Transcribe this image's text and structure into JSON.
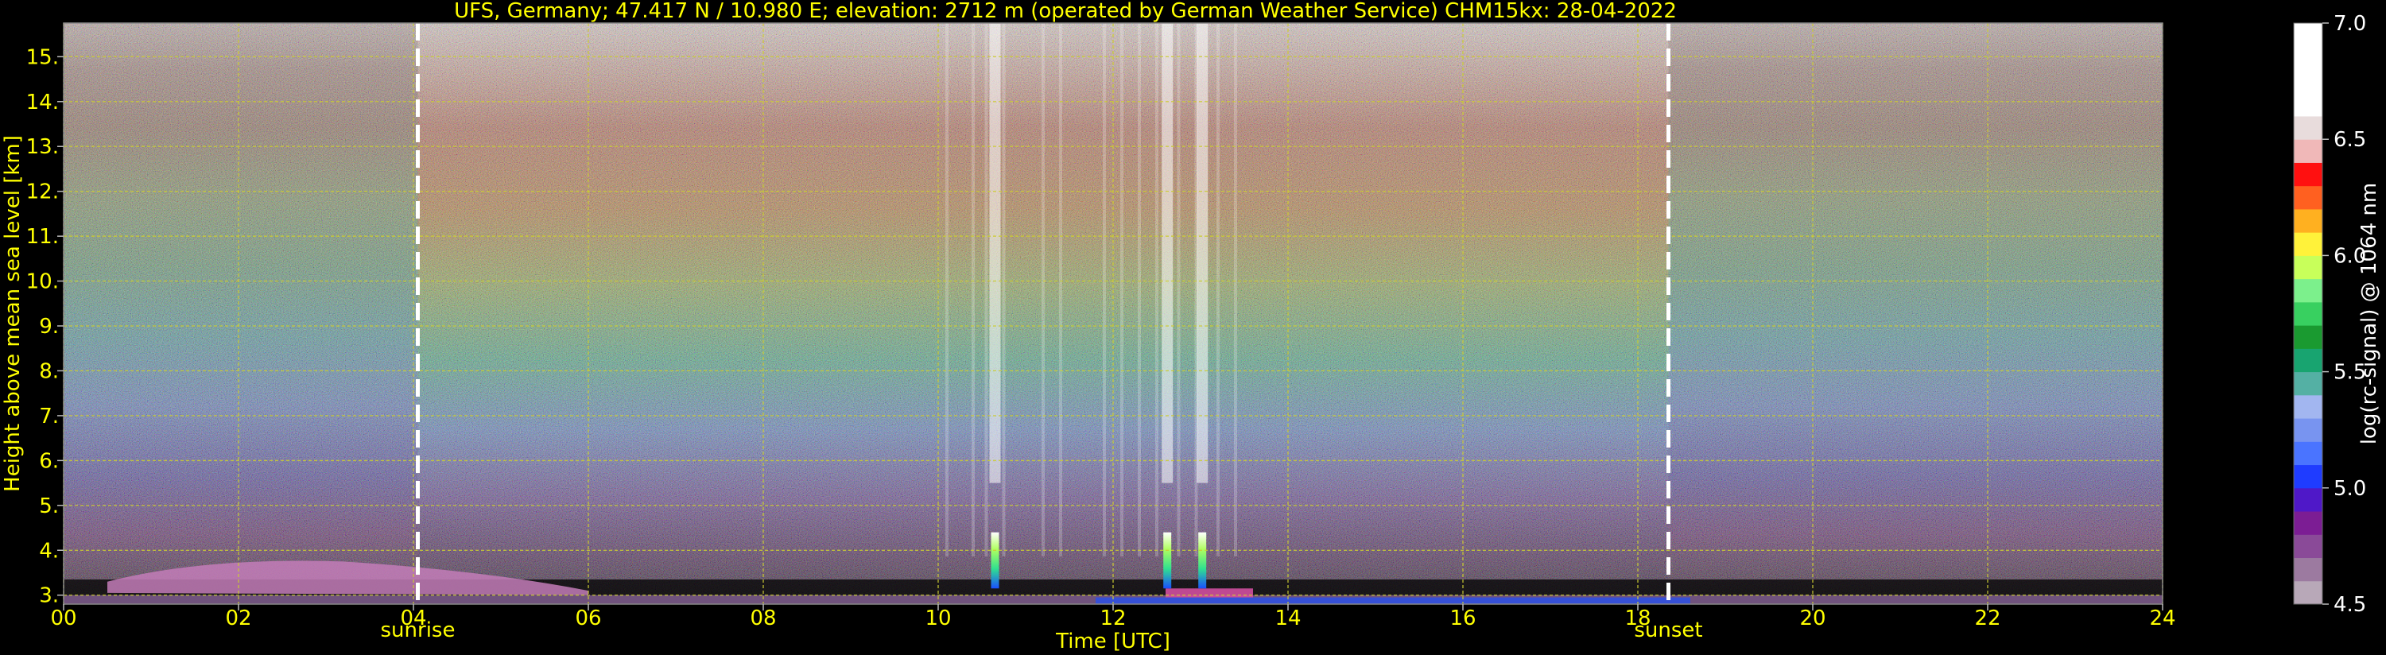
{
  "chart_data": {
    "type": "heatmap",
    "title": "UFS, Germany; 47.417 N / 10.980 E; elevation: 2712 m  (operated by German Weather Service)    CHM15kx: 28-04-2022",
    "xlabel": "Time [UTC]",
    "ylabel": "Height above mean sea level [km]",
    "xlim": [
      0,
      24
    ],
    "ylim": [
      2.8,
      15.75
    ],
    "xticks": [
      "00",
      "02",
      "04",
      "06",
      "08",
      "10",
      "12",
      "14",
      "16",
      "18",
      "20",
      "22",
      "24"
    ],
    "yticks": [
      "3.",
      "4.",
      "5.",
      "6.",
      "7.",
      "8.",
      "9.",
      "10.",
      "11.",
      "12.",
      "13.",
      "14.",
      "15."
    ],
    "grid": true,
    "colorbar": {
      "label": "log(rc-signal) @ 1064 nm",
      "range": [
        4.5,
        7.0
      ],
      "ticks": [
        "4.5",
        "5.0",
        "5.5",
        "6.0",
        "6.5",
        "7.0"
      ]
    },
    "annotations": [
      {
        "label": "sunrise",
        "x": 4.05
      },
      {
        "label": "sunset",
        "x": 18.35
      }
    ],
    "features": {
      "colors": {
        "background": "#000000",
        "axis_text": "#ffff00",
        "grid": "#cccc33",
        "marker": "#ffffff"
      },
      "cloud_columns_x": [
        10.65,
        12.62,
        13.02
      ],
      "residual_layer": {
        "x": [
          0.5,
          6.0
        ],
        "top_km": [
          3.85,
          3.1
        ]
      }
    }
  }
}
